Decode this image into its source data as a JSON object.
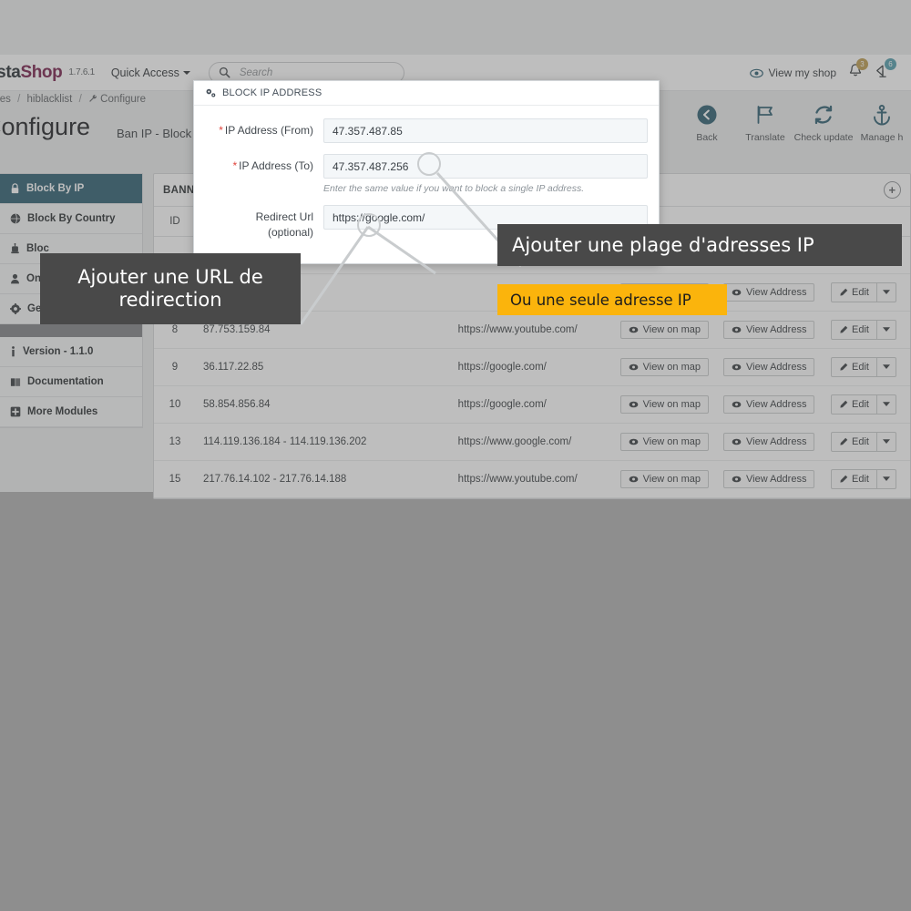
{
  "header": {
    "logo_part1": "estaShop",
    "logo_part2": "Shop",
    "version": "1.7.6.1",
    "quick_access": "Quick Access",
    "search_placeholder": "Search",
    "view_my_shop": "View my shop",
    "bell_badge": "3",
    "antenna_badge": "6"
  },
  "breadcrumb": {
    "item1": "odules",
    "item2": "hiblacklist",
    "item3": "Configure"
  },
  "page": {
    "title": "Configure",
    "subtitle": "Ban IP - Block V"
  },
  "toolbar": {
    "back": "Back",
    "translate": "Translate",
    "check_update": "Check update",
    "manage_hooks": "Manage h"
  },
  "sidebar": {
    "items": [
      {
        "label": "Block By IP",
        "icon": "lock-icon",
        "active": true
      },
      {
        "label": "Block By Country",
        "icon": "globe-icon",
        "active": false
      },
      {
        "label": "Bloc",
        "icon": "robot-icon",
        "active": false
      },
      {
        "label": "Onli",
        "icon": "user-icon",
        "active": false
      },
      {
        "label": "Gene",
        "icon": "gear-icon",
        "active": false
      }
    ],
    "footer_items": [
      {
        "label": "Version - 1.1.0",
        "icon": "info-icon"
      },
      {
        "label": "Documentation",
        "icon": "book-icon"
      },
      {
        "label": "More Modules",
        "icon": "plus-square-icon"
      }
    ]
  },
  "panel": {
    "title": "BANNED I",
    "add_label": "+",
    "columns": {
      "id": "ID",
      "ip": "",
      "url": "",
      "map": "",
      "address": "",
      "actions": ""
    },
    "view_map_label": "View on map",
    "view_address_label": "View Address",
    "edit_label": "Edit",
    "rows": [
      {
        "id": "",
        "ip": "",
        "url": "",
        "occluded": true
      },
      {
        "id": "",
        "ip": "",
        "url": "",
        "occluded": true
      },
      {
        "id": "8",
        "ip": "87.753.159.84",
        "url": "https://www.youtube.com/",
        "occluded": false
      },
      {
        "id": "9",
        "ip": "36.117.22.85",
        "url": "https://google.com/",
        "occluded": false
      },
      {
        "id": "10",
        "ip": "58.854.856.84",
        "url": "https://google.com/",
        "occluded": false
      },
      {
        "id": "13",
        "ip": "114.119.136.184 - 114.119.136.202",
        "url": "https://www.google.com/",
        "occluded": false
      },
      {
        "id": "15",
        "ip": "217.76.14.102 - 217.76.14.188",
        "url": "https://www.youtube.com/",
        "occluded": false
      }
    ]
  },
  "modal": {
    "title": "BLOCK IP ADDRESS",
    "icon": "cogs-icon",
    "fields": {
      "from_label": "IP Address (From)",
      "from_value": "47.357.487.85",
      "to_label": "IP Address (To)",
      "to_value": "47.357.487.256",
      "to_hint": "Enter the same value if you want to block a single IP address.",
      "redirect_label": "Redirect Url",
      "redirect_label2": "(optional)",
      "redirect_value": "https://google.com/"
    }
  },
  "callouts": {
    "range": "Ajouter une plage d'adresses IP",
    "single": "Ou une seule adresse IP",
    "url_line1": "Ajouter une URL de",
    "url_line2": "redirection"
  },
  "colors": {
    "accent_teal": "#1b7b9e",
    "brand_pink": "#cf2077",
    "callout_dark": "#494949",
    "callout_amber": "#fbb40c",
    "required_red": "#e0443c"
  }
}
